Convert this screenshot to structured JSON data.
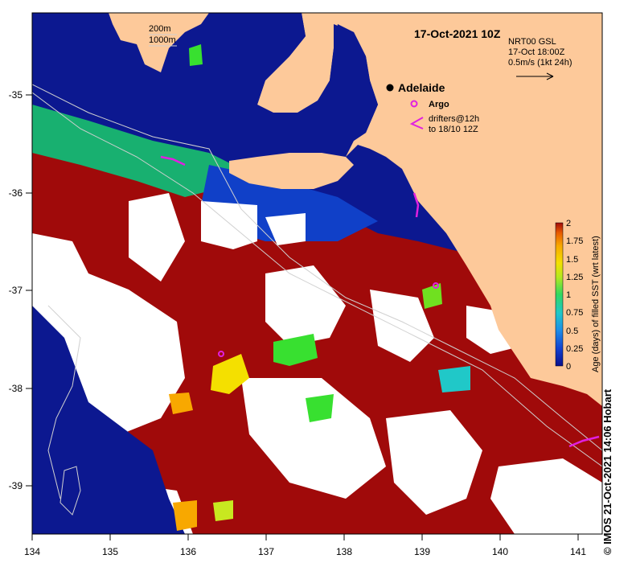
{
  "map": {
    "title": "17-Oct-2021 10Z",
    "x_ticks": [
      "134",
      "135",
      "136",
      "137",
      "138",
      "139",
      "140",
      "141"
    ],
    "y_ticks": [
      "-35",
      "-36",
      "-37",
      "-38",
      "-39"
    ],
    "x_range": [
      134,
      141.3
    ],
    "y_range": [
      -39.5,
      -34.1
    ],
    "bathy_legend": [
      "200m",
      "1000m"
    ],
    "current_key": {
      "line1": "NRT00 GSL",
      "line2": "17-Oct 18:00Z",
      "line3": "0.5m/s (1kt 24h)"
    },
    "city_label": "Adelaide",
    "argo_label": "Argo",
    "drifters_line1": "drifters@12h",
    "drifters_line2": "to 18/10 12Z",
    "credit": "© IMOS 21-Oct-2021 14:06 Hobart"
  },
  "colorbar": {
    "label": "Age (days) of filled SST (wrt latest)",
    "ticks": [
      "2",
      "1.75",
      "1.5",
      "1.25",
      "1",
      "0.75",
      "0.5",
      "0.25",
      "0"
    ],
    "range": [
      0,
      2
    ],
    "colors": [
      "#0a0f8c",
      "#1240d0",
      "#1e8ee8",
      "#20c8c8",
      "#18d080",
      "#38e030",
      "#b4e820",
      "#f4e000",
      "#f8a800",
      "#e85a00",
      "#a00a0a"
    ]
  },
  "colors": {
    "land": "#fdc99a",
    "deep": "#0c1890",
    "old": "#a00a0a",
    "nodata": "#ffffff"
  }
}
